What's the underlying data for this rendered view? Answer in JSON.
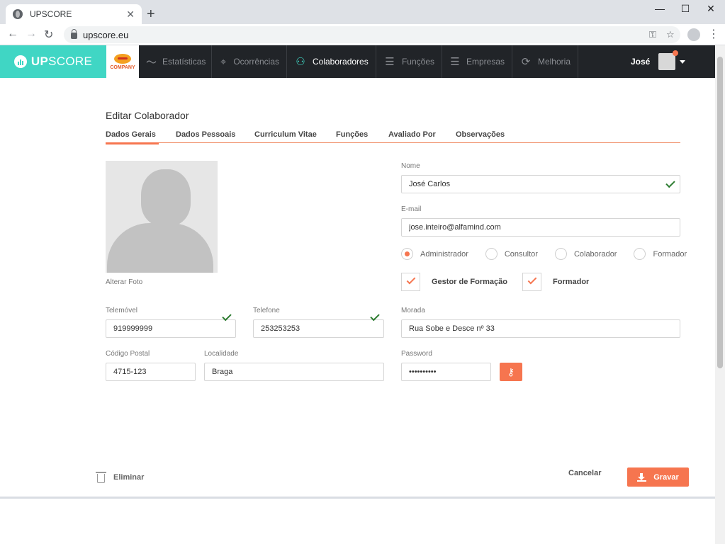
{
  "browser": {
    "tab_title": "UPSCORE",
    "url": "upscore.eu"
  },
  "header": {
    "brand_bold": "UP",
    "brand_rest": "SCORE",
    "company_label": "COMPANY",
    "nav": [
      {
        "label": "Estatísticas",
        "icon": "chart-line-icon"
      },
      {
        "label": "Ocorrências",
        "icon": "target-icon"
      },
      {
        "label": "Colaboradores",
        "icon": "users-icon",
        "active": true
      },
      {
        "label": "Funções",
        "icon": "roles-icon"
      },
      {
        "label": "Empresas",
        "icon": "companies-icon"
      },
      {
        "label": "Melhoria",
        "icon": "refresh-icon"
      }
    ],
    "user_name": "José"
  },
  "form": {
    "title": "Editar Colaborador",
    "tabs": [
      "Dados Gerais",
      "Dados Pessoais",
      "Curriculum Vitae",
      "Funções",
      "Avaliado Por",
      "Observações"
    ],
    "active_tab": "Dados Gerais",
    "photo_link": "Alterar Foto",
    "nome": {
      "label": "Nome",
      "value": "José Carlos"
    },
    "email": {
      "label": "E-mail",
      "value": "jose.inteiro@alfamind.com"
    },
    "roles": [
      {
        "label": "Administrador",
        "selected": true
      },
      {
        "label": "Consultor",
        "selected": false
      },
      {
        "label": "Colaborador",
        "selected": false
      },
      {
        "label": "Formador",
        "selected": false
      }
    ],
    "checks": [
      {
        "label": "Gestor de Formação",
        "checked": true
      },
      {
        "label": "Formador",
        "checked": true
      }
    ],
    "telemovel": {
      "label": "Telemóvel",
      "value": "919999999"
    },
    "telefone": {
      "label": "Telefone",
      "value": "253253253"
    },
    "morada": {
      "label": "Morada",
      "value": "Rua Sobe e Desce nº 33"
    },
    "codigo_postal": {
      "label": "Código Postal",
      "value": "4715-123"
    },
    "localidade": {
      "label": "Localidade",
      "value": "Braga"
    },
    "password": {
      "label": "Password",
      "value": "••••••••••"
    }
  },
  "footer": {
    "delete_label": "Eliminar",
    "cancel_label": "Cancelar",
    "save_label": "Gravar"
  },
  "colors": {
    "accent": "#f6754f",
    "brand": "#40d6c4",
    "header_bg": "#212428",
    "valid": "#2e7d32"
  }
}
